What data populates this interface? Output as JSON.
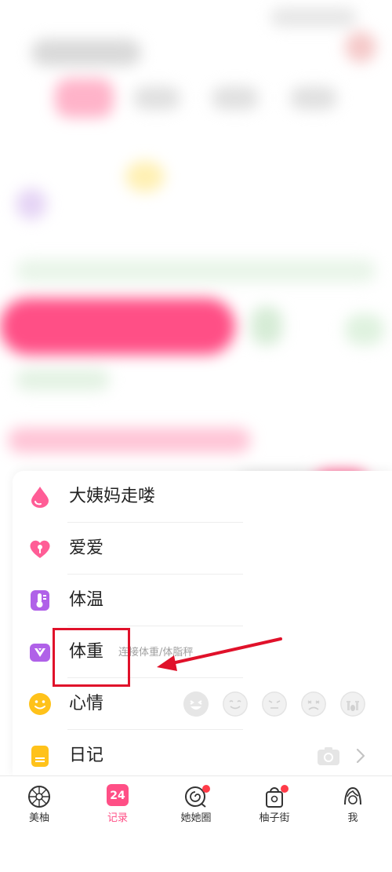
{
  "record_panel": {
    "items": [
      {
        "label": "大姨妈走喽",
        "icon": "period-drop-icon"
      },
      {
        "label": "爱爱",
        "icon": "heart-icon"
      },
      {
        "label": "体温",
        "icon": "thermometer-icon"
      },
      {
        "label": "体重",
        "sub": "连接体重/体脂秤",
        "icon": "weight-scale-icon"
      },
      {
        "label": "心情",
        "icon": "smiley-icon"
      },
      {
        "label": "日记",
        "icon": "diary-icon"
      }
    ]
  },
  "tabbar": {
    "tabs": [
      {
        "label": "美柚",
        "icon": "meiyou-icon",
        "active": false
      },
      {
        "label": "记录",
        "icon": "calendar-icon",
        "badge_text": "24",
        "active": true
      },
      {
        "label": "她她圈",
        "icon": "community-icon",
        "dot": true
      },
      {
        "label": "柚子街",
        "icon": "shop-bag-icon",
        "dot": true
      },
      {
        "label": "我",
        "icon": "profile-icon"
      }
    ]
  },
  "colors": {
    "accent": "#ff4f86",
    "annotation": "#e0112a",
    "icon_purple": "#b061e8",
    "icon_pink": "#ff5d96",
    "icon_yellow": "#ffc21a"
  }
}
